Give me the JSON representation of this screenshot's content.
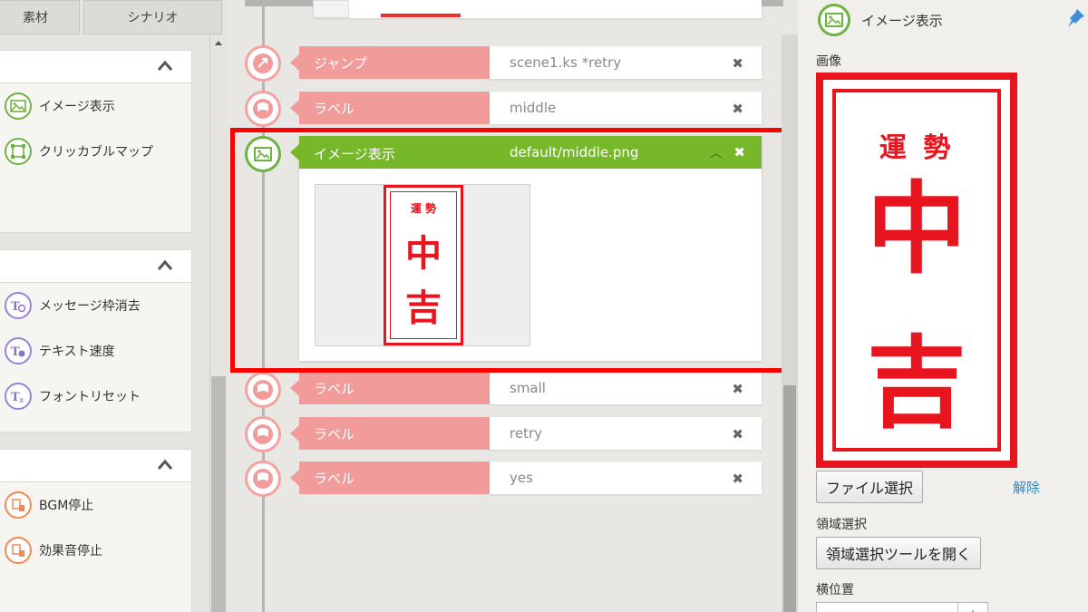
{
  "left_panel": {
    "tabs": [
      {
        "label": "素材"
      },
      {
        "label": "シナリオ"
      }
    ],
    "groups": [
      {
        "items": [
          {
            "label": "イメージ表示",
            "icon": "image-icon"
          },
          {
            "label": "クリッカブルマップ",
            "icon": "map-icon"
          }
        ]
      },
      {
        "items": [
          {
            "label": "メッセージ枠消去",
            "icon": "text-hide-icon"
          },
          {
            "label": "テキスト速度",
            "icon": "text-speed-icon"
          },
          {
            "label": "フォントリセット",
            "icon": "font-reset-icon"
          }
        ]
      },
      {
        "items": [
          {
            "label": "BGM停止",
            "icon": "bgm-stop-icon"
          },
          {
            "label": "効果音停止",
            "icon": "se-stop-icon"
          }
        ]
      }
    ]
  },
  "timeline": {
    "rows": [
      {
        "label": "ジャンプ",
        "value": "scene1.ks *retry",
        "icon": "jump-icon"
      },
      {
        "label": "ラベル",
        "value": "middle",
        "icon": "flag-icon"
      },
      {
        "label": "ラベル",
        "value": "small",
        "icon": "flag-icon"
      },
      {
        "label": "ラベル",
        "value": "retry",
        "icon": "flag-icon"
      },
      {
        "label": "ラベル",
        "value": "yes",
        "icon": "flag-icon"
      }
    ],
    "active": {
      "label": "イメージ表示",
      "value": "default/middle.png",
      "icon": "image-icon"
    },
    "delete_glyph": "✖",
    "collapse_glyph": "︿"
  },
  "fortune": {
    "top": "運 勢",
    "char1": "中",
    "char2": "吉",
    "color": "#e8141e"
  },
  "right_panel": {
    "title": "イメージ表示",
    "image_label": "画像",
    "file_select_button": "ファイル選択",
    "unset_link": "解除",
    "area_select_label": "領域選択",
    "area_select_button": "領域選択ツールを開く",
    "horizontal_label": "横位置"
  },
  "colors": {
    "label_bg": "#f19b9b",
    "active_bg": "#76b82a",
    "highlight": "#ff0000"
  }
}
